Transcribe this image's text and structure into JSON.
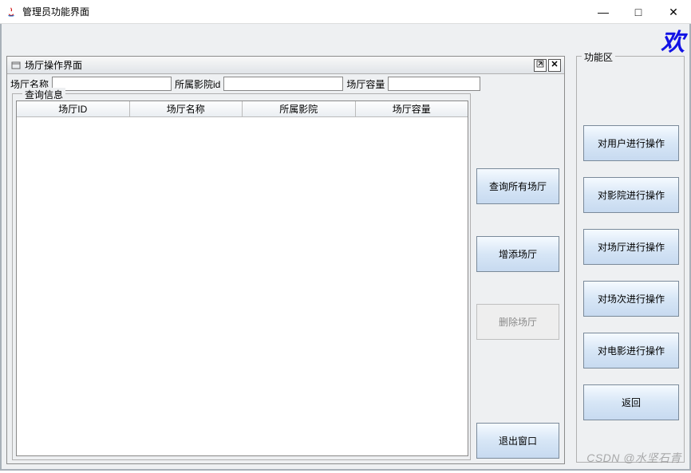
{
  "window": {
    "title": "管理员功能界面",
    "banner_char": "欢"
  },
  "func_panel": {
    "legend": "功能区",
    "buttons": [
      "对用户进行操作",
      "对影院进行操作",
      "对场厅进行操作",
      "对场次进行操作",
      "对电影进行操作",
      "返回"
    ]
  },
  "internal": {
    "title": "场厅操作界面",
    "form": {
      "name_label": "场厅名称",
      "name_value": "",
      "cinema_label": "所属影院id",
      "cinema_value": "",
      "capacity_label": "场厅容量",
      "capacity_value": ""
    },
    "query_legend": "查询信息",
    "columns": [
      "场厅ID",
      "场厅名称",
      "所属影院",
      "场厅容量"
    ],
    "side_buttons": {
      "query_all": "查询所有场厅",
      "add": "增添场厅",
      "delete": "删除场厅",
      "exit": "退出窗口"
    }
  },
  "watermark": "CSDN @水坚石青"
}
